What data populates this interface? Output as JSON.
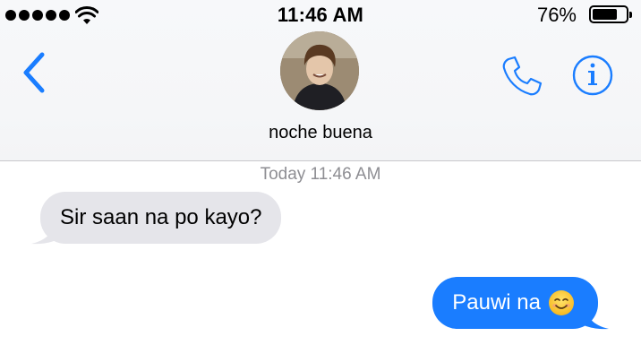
{
  "status_bar": {
    "time": "11:46 AM",
    "battery_percent_label": "76%",
    "battery_level": 0.76,
    "signal_icon": "signal-dots-icon",
    "wifi_icon": "wifi-icon"
  },
  "header": {
    "back_icon": "chevron-left-icon",
    "contact_name": "noche buena",
    "phone_icon": "phone-icon",
    "info_icon": "info-icon",
    "accent_color": "#1a7dff"
  },
  "conversation": {
    "timestamp_day": "Today",
    "timestamp_time": "11:46 AM",
    "messages": [
      {
        "direction": "incoming",
        "text": "Sir saan na po kayo?",
        "color": "#e5e5ea"
      },
      {
        "direction": "outgoing",
        "text": "Pauwi na",
        "emoji": "smiling-face-emoji",
        "color": "#1a7dff"
      }
    ]
  }
}
